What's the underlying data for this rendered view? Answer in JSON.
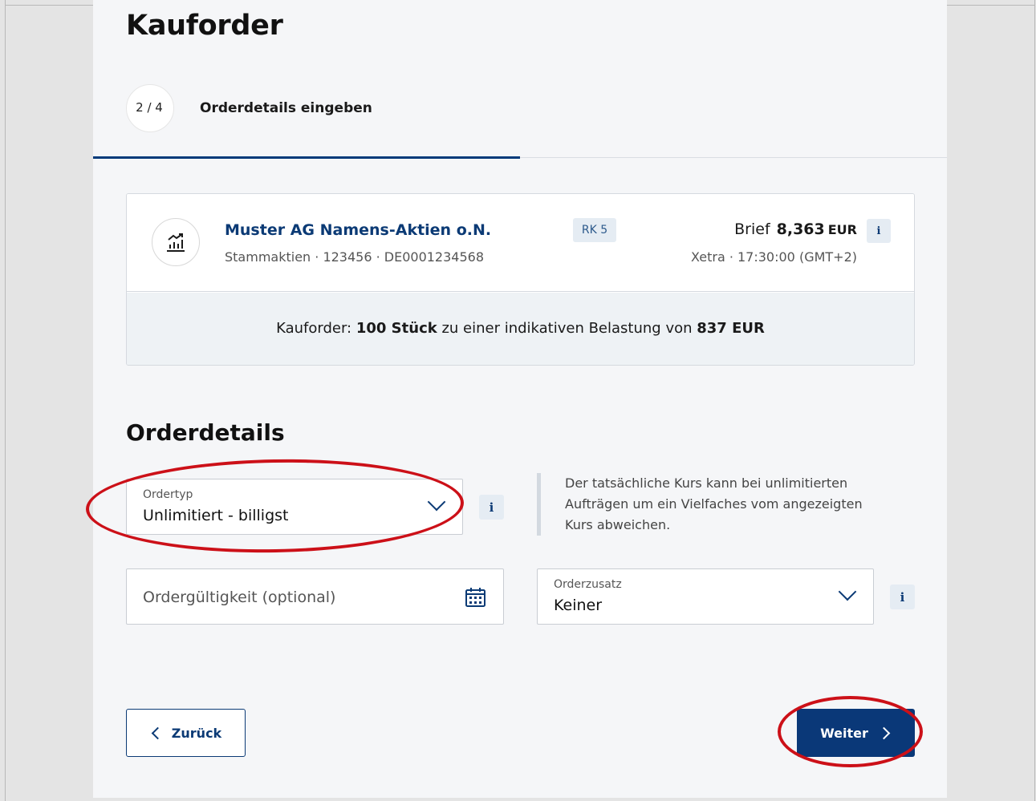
{
  "header": {
    "title": "Kauforder",
    "step_counter": "2 / 4",
    "step_label": "Orderdetails eingeben"
  },
  "progress": {
    "current_step": 2,
    "total_steps": 4,
    "fraction": 0.5
  },
  "instrument": {
    "icon": "stock-chart-icon",
    "name": "Muster AG Namens-Aktien o.N.",
    "details": "Stammaktien · 123456 · DE0001234568",
    "risk_class": "RK 5",
    "price_type": "Brief",
    "price_value": "8,363",
    "price_currency": "EUR",
    "market": "Xetra · 17:30:00 (GMT+2)",
    "info_label": "i"
  },
  "summary": {
    "prefix": "Kauforder: ",
    "quantity": "100 Stück",
    "middle": " zu einer indikativen Belastung von ",
    "amount": "837 EUR"
  },
  "orderdetails": {
    "section_title": "Orderdetails",
    "ordertyp": {
      "label": "Ordertyp",
      "value": "Unlimitiert - billigst",
      "info_label": "i"
    },
    "hint": "Der tatsächliche Kurs kann bei unlimitierten Aufträgen um ein Vielfaches vom angezeigten Kurs abweichen.",
    "validity": {
      "placeholder": "Ordergültigkeit (optional)",
      "icon": "calendar-icon"
    },
    "orderzusatz": {
      "label": "Orderzusatz",
      "value": "Keiner",
      "info_label": "i"
    }
  },
  "actions": {
    "back_label": "Zurück",
    "next_label": "Weiter"
  },
  "colors": {
    "primary": "#0a3878",
    "annotation": "#cc1018",
    "badge_bg": "#e5ecf3"
  }
}
